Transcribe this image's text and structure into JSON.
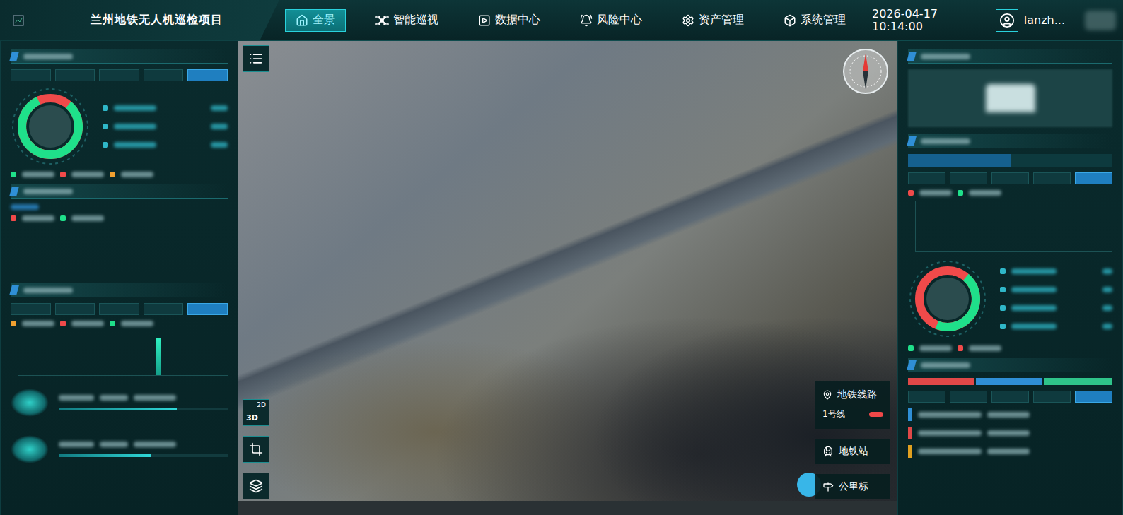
{
  "header": {
    "title": "兰州地铁无人机巡检项目",
    "date": "2026-04-17",
    "time": "10:14:00",
    "user": "lanzh..."
  },
  "nav": [
    {
      "label": "全景",
      "selected": true
    },
    {
      "label": "智能巡视",
      "selected": false
    },
    {
      "label": "数据中心",
      "selected": false
    },
    {
      "label": "风险中心",
      "selected": false
    },
    {
      "label": "资产管理",
      "selected": false
    },
    {
      "label": "系统管理",
      "selected": false
    }
  ],
  "map": {
    "view_toggle": {
      "top": "2D",
      "bottom": "3D"
    },
    "legend": {
      "title": "地铁线路",
      "lines": [
        {
          "label": "1号线",
          "color": "#f04848"
        }
      ]
    },
    "layers": [
      {
        "label": "地铁站"
      },
      {
        "label": "公里标"
      }
    ]
  },
  "left_panel": {
    "operation": {
      "tabs": [
        {
          "selected": false
        },
        {
          "selected": false
        },
        {
          "selected": false
        },
        {
          "selected": false
        },
        {
          "selected": true
        }
      ],
      "donut": {
        "level": 0.82
      },
      "rows": [
        {
          "color": "#2fb7c8"
        },
        {
          "color": "#2fb7c8"
        },
        {
          "color": "#2fb7c8"
        }
      ],
      "legend": [
        {
          "color": "#1fe08a"
        },
        {
          "color": "#f04a4a"
        },
        {
          "color": "#f0a030"
        }
      ]
    },
    "trend": {
      "legend": [
        {
          "color": "#f04a4a"
        },
        {
          "color": "#1fe08a"
        }
      ]
    },
    "assets": {
      "tabs": [
        {
          "selected": false
        },
        {
          "selected": false
        },
        {
          "selected": false
        },
        {
          "selected": false
        },
        {
          "selected": true
        }
      ],
      "legend": [
        {
          "color": "#f0a030"
        },
        {
          "color": "#f04a4a"
        },
        {
          "color": "#1fe08a"
        }
      ],
      "values": [
        0,
        0,
        0,
        0,
        0,
        3,
        0,
        0
      ]
    },
    "cards": [
      {
        "level": 0.7
      },
      {
        "level": 0.55
      }
    ]
  },
  "right_panel": {
    "split_tabs": [
      {
        "selected": true
      },
      {
        "selected": false
      }
    ],
    "tabs": [
      {
        "selected": false
      },
      {
        "selected": false
      },
      {
        "selected": false
      },
      {
        "selected": false
      },
      {
        "selected": true
      }
    ],
    "chart_legend": [
      {
        "color": "#f04a4a"
      },
      {
        "color": "#1fe08a"
      }
    ],
    "donut": {
      "level": 0.45
    },
    "donut_rows": [
      {
        "color": "#2fb7c8"
      },
      {
        "color": "#2fb7c8"
      },
      {
        "color": "#2fb7c8"
      },
      {
        "color": "#2fb7c8"
      }
    ],
    "donut_legend": [
      {
        "color": "#1fe08a"
      },
      {
        "color": "#f04a4a"
      }
    ],
    "bars": [
      {
        "color": "#e04848",
        "level": 0.33
      },
      {
        "color": "#2f8fd6",
        "level": 0.33
      },
      {
        "color": "#2fc48a",
        "level": 0.34
      }
    ],
    "bottom_tabs": [
      {
        "selected": false
      },
      {
        "selected": false
      },
      {
        "selected": false
      },
      {
        "selected": false
      },
      {
        "selected": true
      }
    ],
    "list": [
      {
        "color": "#2f8fd6"
      },
      {
        "color": "#e04848"
      },
      {
        "color": "#e0a020"
      }
    ]
  }
}
